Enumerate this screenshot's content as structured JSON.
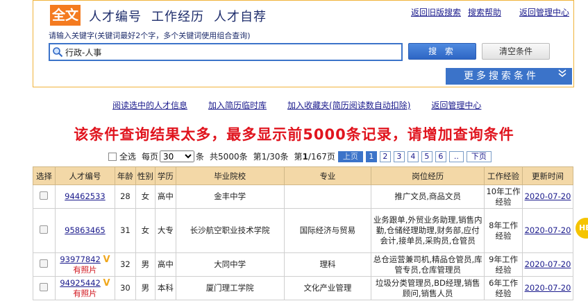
{
  "search": {
    "mode_badge": "全文",
    "tabs": [
      "人才编号",
      "工作经历",
      "人才自荐"
    ],
    "links": [
      "返回旧版搜索",
      "搜索帮助",
      "返回管理中心"
    ],
    "hint": "请输入关键字(关键词最好2个字，多个关键词使用组合查询)",
    "query": "行政-人事",
    "search_button": "搜 索",
    "clear_button": "清空条件",
    "more_label": "更多搜索条件"
  },
  "actions": [
    "阅读选中的人才信息",
    "加入简历临时库",
    "加入收藏夹(简历阅读数自动扣除)",
    "返回管理中心"
  ],
  "warning": "该条件查询结果太多，最多显示前5000条记录，请增加查询条件",
  "pager": {
    "select_all": "全选",
    "per_page_label": "每页",
    "per_page_value": "30",
    "per_page_unit": "条",
    "total": "共5000条",
    "page_of": "第1/30条",
    "page_prefix": "第",
    "page_current": "1",
    "page_suffix": "/167页",
    "prev": "上页",
    "pages": [
      "1",
      "2",
      "3",
      "4",
      "5",
      "6",
      ".."
    ],
    "next": "下页"
  },
  "table": {
    "headers": [
      "选择",
      "人才编号",
      "年龄",
      "性别",
      "学历",
      "毕业院校",
      "专业",
      "岗位经历",
      "工作经验",
      "更新时间"
    ],
    "rows": [
      {
        "id": "94462533",
        "photo": "",
        "age": "28",
        "gender": "女",
        "edu": "高中",
        "school": "金丰中学",
        "major": "",
        "jobs": "推广文员,商品文员",
        "exp": "10年工作经验",
        "updated": "2020-07-20"
      },
      {
        "id": "95863465",
        "photo": "",
        "age": "31",
        "gender": "女",
        "edu": "大专",
        "school": "长沙航空职业技术学院",
        "major": "国际经济与贸易",
        "jobs": "业务跟单,外贸业务助理,销售内勤,仓储经理助理,财务部,应付会计,接单员,采购员,仓管员",
        "exp": "8年工作经验",
        "updated": "2020-07-20"
      },
      {
        "id": "93977842",
        "photo": "有照片",
        "age": "32",
        "gender": "男",
        "edu": "高中",
        "school": "大同中学",
        "major": "理科",
        "jobs": "总仓运营兼司机,精品仓管员,库管专员,仓库管理员",
        "exp": "9年工作经验",
        "updated": "2020-07-20"
      },
      {
        "id": "94925442",
        "photo": "有照片",
        "age": "30",
        "gender": "男",
        "edu": "本科",
        "school": "厦门理工学院",
        "major": "文化产业管理",
        "jobs": "垃圾分类管理员,BD经理,销售顾问,销售人员",
        "exp": "6年工作经验",
        "updated": "2020-07-20"
      }
    ]
  },
  "side_float": "HE"
}
